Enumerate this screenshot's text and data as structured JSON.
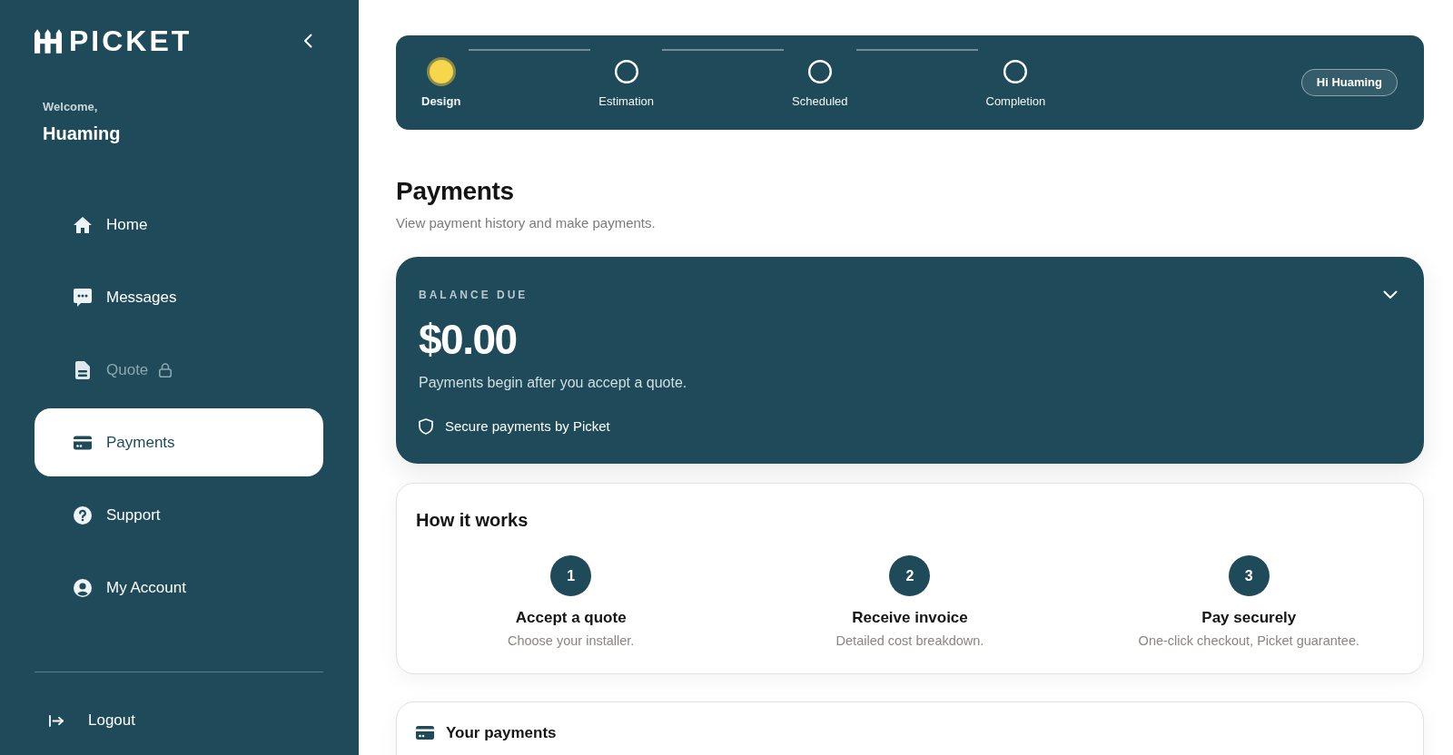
{
  "sidebar": {
    "logo": "PICKET",
    "welcome": "Welcome,",
    "user_name": "Huaming",
    "nav_items": [
      {
        "label": "Home",
        "selected": false,
        "locked": false
      },
      {
        "label": "Messages",
        "selected": false,
        "locked": false
      },
      {
        "label": "Quote",
        "selected": false,
        "locked": true
      },
      {
        "label": "Payments",
        "selected": true,
        "locked": false
      },
      {
        "label": "Support",
        "selected": false,
        "locked": false
      },
      {
        "label": "My Account",
        "selected": false,
        "locked": false
      }
    ],
    "logout": "Logout"
  },
  "progress": {
    "steps": [
      {
        "label": "Design",
        "current": true
      },
      {
        "label": "Estimation",
        "current": false
      },
      {
        "label": "Scheduled",
        "current": false
      },
      {
        "label": "Completion",
        "current": false
      }
    ],
    "greeting": "Hi Huaming"
  },
  "header": {
    "title": "Payments",
    "subtitle": "View payment history and make payments."
  },
  "balance": {
    "label": "BALANCE DUE",
    "amount": "$0.00",
    "note": "Payments begin after you accept a quote.",
    "secure_note": "Secure payments by Picket"
  },
  "how_it_works": {
    "title": "How it works",
    "steps": [
      {
        "number": "1",
        "title": "Accept a quote",
        "description": "Choose your installer."
      },
      {
        "number": "2",
        "title": "Receive invoice",
        "description": "Detailed cost breakdown."
      },
      {
        "number": "3",
        "title": "Pay securely",
        "description": "One-click checkout, Picket guarantee."
      }
    ]
  },
  "payments": {
    "title": "Your payments"
  }
}
